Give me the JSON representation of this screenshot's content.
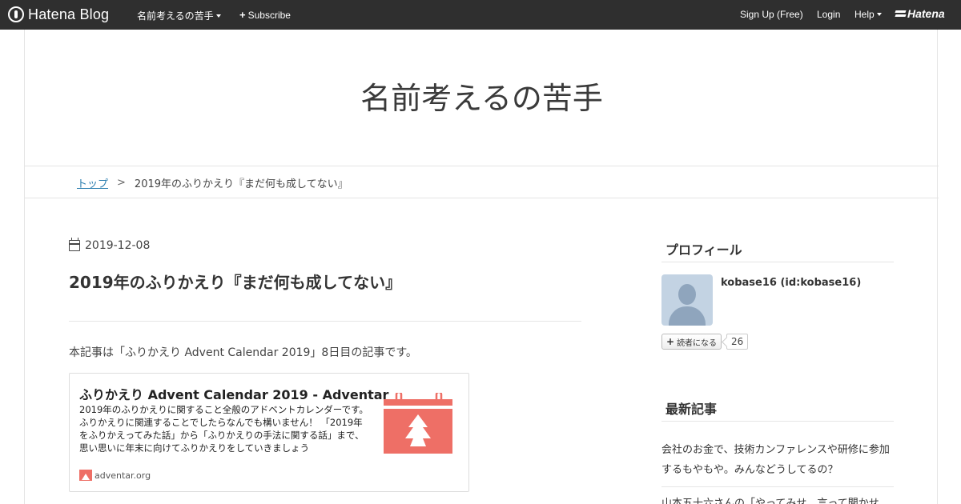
{
  "topbar": {
    "brand": "Hatena Blog",
    "blog_menu": "名前考えるの苦手",
    "subscribe": "Subscribe",
    "signup": "Sign Up (Free)",
    "login": "Login",
    "help": "Help",
    "hatena": "Hatena"
  },
  "blog": {
    "title": "名前考えるの苦手"
  },
  "breadcrumb": {
    "top": "トップ",
    "separator": ">",
    "current": "2019年のふりかえり『まだ何も成してない』"
  },
  "article": {
    "date": "2019-12-08",
    "title": "2019年のふりかえり『まだ何も成してない』",
    "intro": "本記事は「ふりかえり Advent Calendar 2019」8日目の記事です。",
    "embed": {
      "title": "ふりかえり Advent Calendar 2019 - Adventar",
      "description": "2019年のふりかえりに関すること全般のアドベントカレンダーです。 ふりかえりに関連することでしたらなんでも構いません！ 「2019年をふりかえってみた話」から「ふりかえりの手法に関する話」まで、思い思いに年末に向けてふりかえりをしていきましょう",
      "site": "adventar.org",
      "accent_color": "#ee6f66"
    }
  },
  "sidebar": {
    "profile_heading": "プロフィール",
    "profile_name": "kobase16 (id:kobase16)",
    "subscribe_label": "読者になる",
    "subscriber_count": "26",
    "recent_heading": "最新記事",
    "recent": [
      "会社のお金で、技術カンファレンスや研修に参加するもやもや。みんなどうしてるの？",
      "山本五十六さんの「やってみせ、言って聞かせ"
    ]
  }
}
